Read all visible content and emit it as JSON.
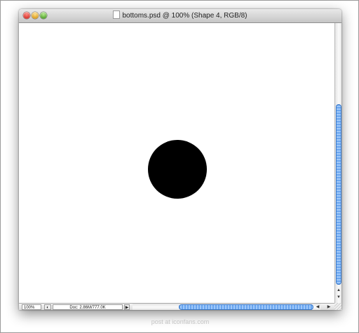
{
  "window": {
    "title": "bottoms.psd @ 100% (Shape 4, RGB/8)",
    "buttons": [
      "close",
      "minimize",
      "zoom"
    ]
  },
  "canvas": {
    "background": "#ffffff",
    "shape_color": "#000000"
  },
  "statusbar": {
    "zoom": "100%",
    "doc_info": "Doc: 2.86M/777.0K",
    "arrow": "▶"
  },
  "scrollbars": {
    "accent": "#6aa6f0",
    "up_arrow": "▲",
    "down_arrow": "▼",
    "left_arrow": "◀",
    "right_arrow": "▶"
  },
  "watermark": "post at iconfans.com"
}
